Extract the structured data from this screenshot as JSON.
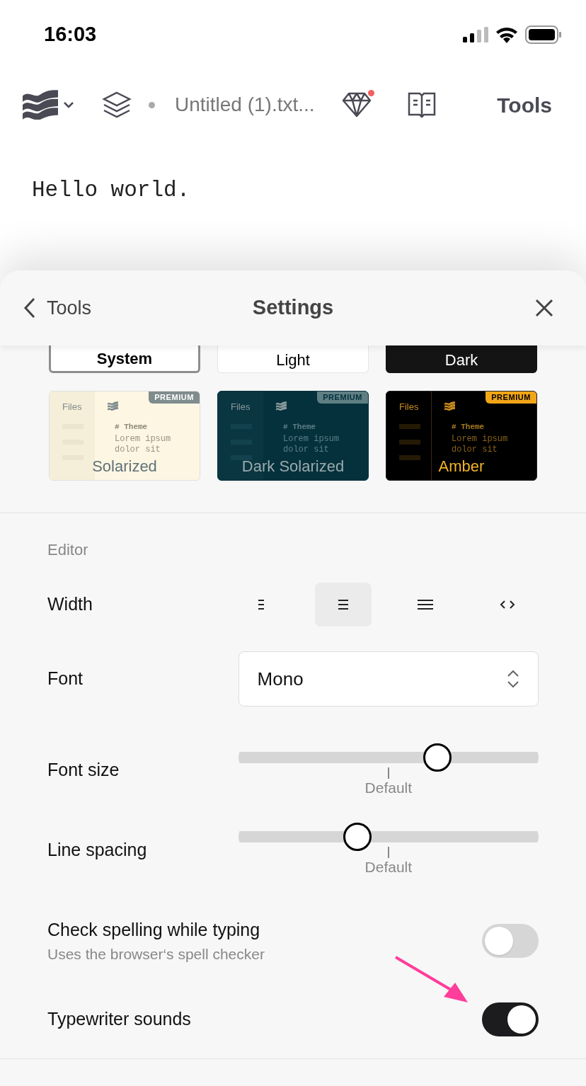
{
  "status_bar": {
    "time": "16:03"
  },
  "toolbar": {
    "file_name": "Untitled (1).txt...",
    "tools": "Tools",
    "notification": true
  },
  "editor": {
    "text": "Hello world."
  },
  "sheet": {
    "back": "Tools",
    "title": "Settings"
  },
  "themes": [
    {
      "name": "System",
      "kind": "cut",
      "selected": true
    },
    {
      "name": "Light",
      "kind": "cut",
      "selected": false
    },
    {
      "name": "Dark",
      "kind": "cut",
      "selected": false
    },
    {
      "name": "Solarized",
      "kind": "full",
      "selected": false,
      "premium": true,
      "badge": "PREMIUM",
      "files": "Files",
      "heading": "# Theme",
      "preview": [
        "Lorem ipsum",
        "dolor sit"
      ]
    },
    {
      "name": "Dark Solarized",
      "kind": "full",
      "selected": false,
      "premium": true,
      "badge": "PREMIUM",
      "files": "Files",
      "heading": "# Theme",
      "preview": [
        "Lorem ipsum",
        "dolor sit"
      ]
    },
    {
      "name": "Amber",
      "kind": "full",
      "selected": false,
      "premium": true,
      "badge": "PREMIUM",
      "files": "Files",
      "heading": "# Theme",
      "preview": [
        "Lorem ipsum",
        "dolor sit"
      ]
    }
  ],
  "editor_section": {
    "label": "Editor",
    "width": {
      "label": "Width",
      "options": [
        {
          "kind": "narrow",
          "selected": false
        },
        {
          "kind": "medium",
          "selected": true
        },
        {
          "kind": "wide",
          "selected": false
        },
        {
          "kind": "code",
          "selected": false
        }
      ]
    },
    "font": {
      "label": "Font",
      "value": "Mono"
    },
    "font_size": {
      "label": "Font size",
      "level": 0.68,
      "default_label": "Default"
    },
    "line_spacing": {
      "label": "Line spacing",
      "level": 0.386,
      "default_label": "Default"
    },
    "toggles": [
      {
        "label": "Check spelling while typing",
        "description": "Uses the browser‘s spell checker",
        "on": false
      },
      {
        "label": "Typewriter sounds",
        "on": true
      }
    ]
  }
}
